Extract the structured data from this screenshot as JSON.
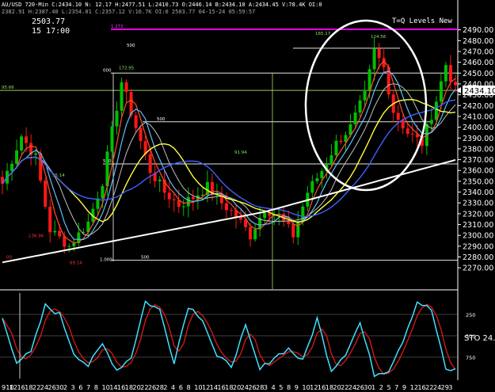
{
  "header": {
    "line1": "AU/USD 720-Min C:2434.10 N: 12.17 H:2477.51 L:2410.73 O:2446.14 B:2434.10 A:2434.45 V:78.4K OI:0",
    "line2": "2382.91 H:2387.40 L:2354.01 C:2357.12 V:16.7K OI:0 2503.77 04-15-24 05:59:57",
    "price": "2503.77",
    "date": "15 17:00"
  },
  "indicator_title": "T=Q Levels New",
  "last_price_tag": "2434.10",
  "colors": {
    "background": "#000000",
    "up_candle": "#00c000",
    "down_candle": "#ff1818",
    "ma_fast": "#ff5030",
    "ma_mid": "#60c0ff",
    "ma_slow1": "#ffff40",
    "ma_slow2": "#4060ff",
    "ma_long": "#ffffff",
    "stoch_k": "#40e0ff",
    "stoch_d": "#e01818",
    "level_magenta": "#ff00ff",
    "level_green": "#a8e060"
  },
  "chart_data": {
    "type": "candlestick",
    "y_axis": {
      "ticks": [
        "2490.00",
        "2480.00",
        "2470.00",
        "2460.00",
        "2450.00",
        "2440.00",
        "2430.00",
        "2420.00",
        "2410.00",
        "2400.00",
        "2390.00",
        "2380.00",
        "2370.00",
        "2360.00",
        "2350.00",
        "2340.00",
        "2330.00",
        "2320.00",
        "2310.00",
        "2300.00",
        "2290.00",
        "2280.00",
        "2270.00"
      ],
      "ylim": [
        2265,
        2500
      ]
    },
    "x_axis": {
      "labels": [
        "910",
        "12",
        "16",
        "18",
        "22",
        "24",
        "26",
        "30",
        "2",
        "3",
        "6",
        "7",
        "8",
        "10",
        "14",
        "16",
        "18",
        "20",
        "22",
        "26",
        "28",
        "2",
        "4",
        "6",
        "8",
        "10",
        "12",
        "14",
        "16",
        "18",
        "20",
        "24",
        "26",
        "28",
        "3",
        "4",
        "5",
        "8",
        "9",
        "10",
        "12",
        "16",
        "18",
        "20",
        "22",
        "24",
        "26",
        "30",
        "1",
        "2",
        "5",
        "7",
        "9",
        "12",
        "16",
        "22",
        "24",
        "29",
        "3"
      ]
    },
    "price_labels": [
      {
        "text": "1.272",
        "price": 2490.5
      },
      {
        "text": "500",
        "price": 2473
      },
      {
        "text": "165.17",
        "price": 2484
      },
      {
        "text": "124.56",
        "price": 2481
      },
      {
        "text": "000",
        "price": 2450
      },
      {
        "text": "172.95",
        "price": 2452
      },
      {
        "text": "95.66",
        "price": 2434
      },
      {
        "text": "500",
        "price": 2405
      },
      {
        "text": "91.94",
        "price": 2374
      },
      {
        "text": "500",
        "price": 2366
      },
      {
        "text": "55.14",
        "price": 2353
      },
      {
        "text": "-136.96",
        "price": 2297
      },
      {
        "text": "1.000",
        "price": 2275
      },
      {
        "text": "500",
        "price": 2277
      },
      {
        "text": "69.14",
        "price": 2272
      },
      {
        "text": "00",
        "price": 2277
      }
    ],
    "levels": [
      {
        "price": 2490.5,
        "color": "magenta"
      },
      {
        "price": 2473,
        "color": "white"
      },
      {
        "price": 2450,
        "color": "white"
      },
      {
        "price": 2434,
        "color": "green"
      },
      {
        "price": 2405,
        "color": "white"
      },
      {
        "price": 2366,
        "color": "white"
      },
      {
        "price": 2277,
        "color": "white"
      }
    ],
    "candle_count": 96,
    "candles_anchor": [
      [
        0,
        2348
      ],
      [
        4,
        2392
      ],
      [
        7,
        2372
      ],
      [
        10,
        2305
      ],
      [
        14,
        2290
      ],
      [
        18,
        2312
      ],
      [
        21,
        2350
      ],
      [
        25,
        2442
      ],
      [
        28,
        2400
      ],
      [
        31,
        2360
      ],
      [
        34,
        2340
      ],
      [
        37,
        2328
      ],
      [
        40,
        2335
      ],
      [
        43,
        2345
      ],
      [
        46,
        2330
      ],
      [
        49,
        2318
      ],
      [
        52,
        2300
      ],
      [
        55,
        2325
      ],
      [
        58,
        2318
      ],
      [
        61,
        2300
      ],
      [
        64,
        2340
      ],
      [
        67,
        2360
      ],
      [
        70,
        2385
      ],
      [
        73,
        2400
      ],
      [
        76,
        2430
      ],
      [
        78,
        2470
      ],
      [
        80,
        2455
      ],
      [
        82,
        2415
      ],
      [
        85,
        2395
      ],
      [
        88,
        2385
      ],
      [
        91,
        2425
      ],
      [
        93,
        2458
      ],
      [
        95,
        2434
      ]
    ],
    "stochastic": {
      "label": "STO 24.",
      "ticks": [
        "250",
        "500",
        "750"
      ],
      "k_anchor": [
        [
          0,
          70
        ],
        [
          3,
          20
        ],
        [
          6,
          30
        ],
        [
          9,
          85
        ],
        [
          12,
          75
        ],
        [
          15,
          30
        ],
        [
          18,
          15
        ],
        [
          21,
          40
        ],
        [
          24,
          10
        ],
        [
          27,
          25
        ],
        [
          30,
          90
        ],
        [
          33,
          80
        ],
        [
          36,
          20
        ],
        [
          39,
          85
        ],
        [
          42,
          70
        ],
        [
          45,
          25
        ],
        [
          48,
          15
        ],
        [
          51,
          60
        ],
        [
          54,
          10
        ],
        [
          57,
          25
        ],
        [
          60,
          35
        ],
        [
          63,
          20
        ],
        [
          66,
          70
        ],
        [
          69,
          10
        ],
        [
          72,
          30
        ],
        [
          75,
          65
        ],
        [
          78,
          5
        ],
        [
          81,
          10
        ],
        [
          84,
          45
        ],
        [
          87,
          90
        ],
        [
          90,
          80
        ],
        [
          93,
          10
        ]
      ]
    }
  }
}
